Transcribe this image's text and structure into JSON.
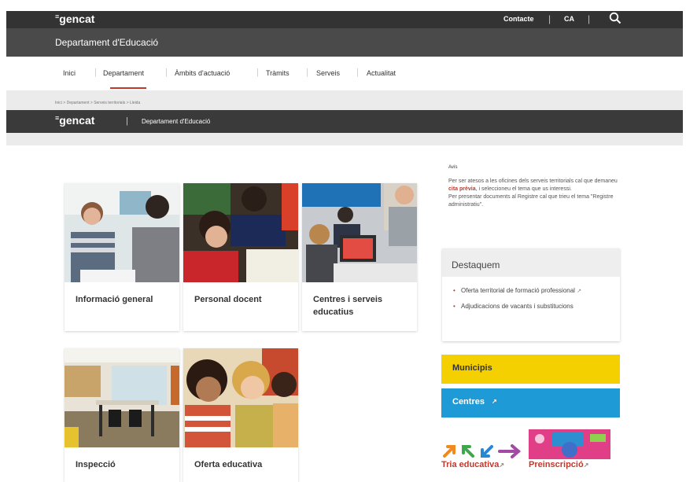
{
  "header": {
    "logo": "gencat",
    "contact": "Contacte",
    "lang": "CA",
    "department": "Departament d'Educació"
  },
  "nav": {
    "items": [
      "Inici",
      "Departament",
      "Àmbits d'actuació",
      "Tràmits",
      "Serveis",
      "Actualitat"
    ],
    "active": "Departament"
  },
  "breadcrumb": "Inici > Departament > Serveis territorials > Lleida",
  "sticky": {
    "logo": "gencat",
    "department": "Departament d'Educació"
  },
  "cards": [
    {
      "title": "Informació general"
    },
    {
      "title": "Personal docent"
    },
    {
      "title": "Centres i serveis educatius"
    },
    {
      "title": "Inspecció"
    },
    {
      "title": "Oferta educativa"
    }
  ],
  "avis": {
    "heading": "Avís",
    "line1_pre": "Per ser atesos a les oficines dels serveis territorials cal que demaneu ",
    "line1_link": "cita prèvia",
    "line1_post": ", i seleccioneu el tema que us interessi.",
    "line2": "Per presentar documents al Registre cal que trieu el tema \"Registre administratiu\"."
  },
  "destaquem": {
    "title": "Destaquem",
    "items": [
      "Oferta territorial de formació professional",
      "Adjudicacions de vacants i substitucions"
    ]
  },
  "buttons": {
    "municipis": "Municipis",
    "centres": "Centres"
  },
  "promos": {
    "tria": "Tria educativa",
    "preinscripcio": "Preinscripció"
  },
  "colors": {
    "topbar": "#333333",
    "brandbar": "#4a4a4a",
    "accent_red": "#c0392b",
    "yellow": "#f5d000",
    "blue": "#1e9ad6"
  }
}
